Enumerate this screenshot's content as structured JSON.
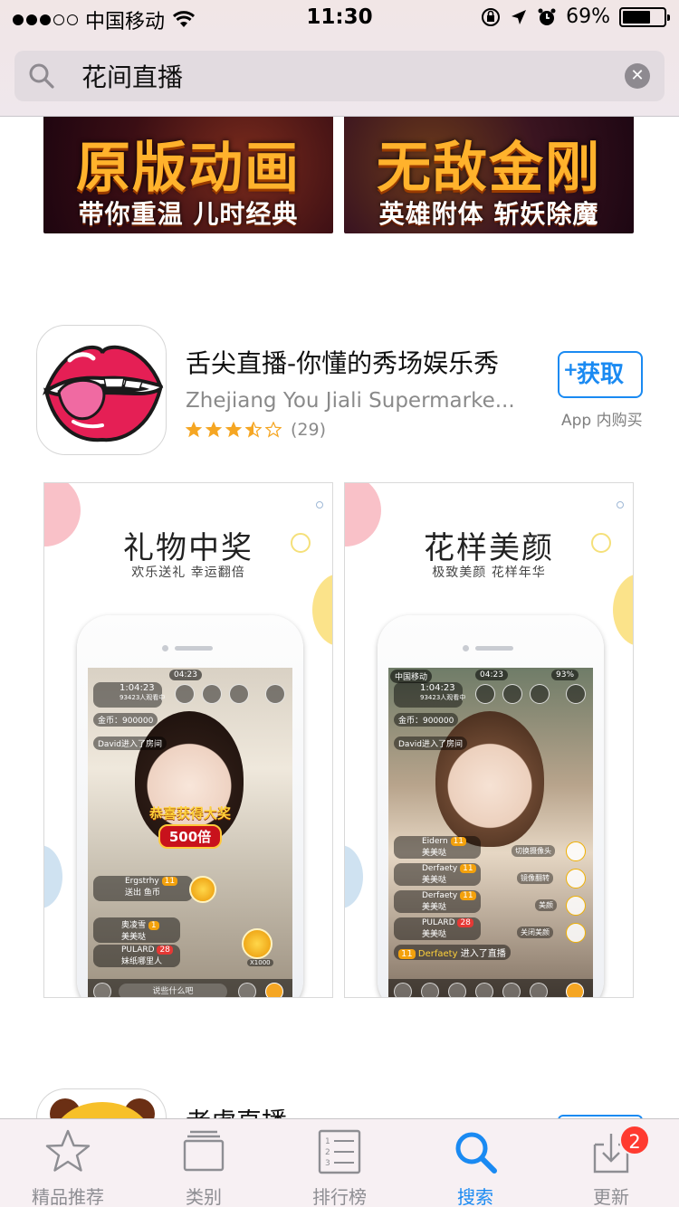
{
  "status_bar": {
    "carrier": "中国移动",
    "time": "11:30",
    "battery_percent": "69%",
    "battery_level": 0.69,
    "signal_bars_filled": 3,
    "signal_bars_total": 5
  },
  "search": {
    "query": "花间直播"
  },
  "banners": [
    {
      "headline": "原版动画",
      "tagline": "带你重温 儿时经典"
    },
    {
      "headline": "无敌金刚",
      "tagline": "英雄附体 斩妖除魔"
    }
  ],
  "app": {
    "title": "舌尖直播-你懂的秀场娱乐秀",
    "developer": "Zhejiang You Jiali Supermarke...",
    "rating_stars": 3.5,
    "rating_count": "(29)",
    "get_label": "获取",
    "get_plus": "+",
    "iap_note": "App 内购买"
  },
  "screenshots": [
    {
      "headline": "礼物中奖",
      "sub": "欢乐送礼  幸运翻倍",
      "status_time": "04:23",
      "live_time": "1:04:23",
      "viewers": "93423人观看中",
      "coins": "金币：900000",
      "join_msg": "David进入了房间",
      "award_title": "恭喜获得大奖",
      "award_value": "500倍",
      "gift_user": "Ergstrhy",
      "gift_level": "11",
      "gift_text": "送出  鱼币",
      "chat1_user": "奥凌雪",
      "chat1_level": "1",
      "chat1_text": "美美哒",
      "chat2_user": "PULARD",
      "chat2_level": "28",
      "chat2_text": "妹纸哪里人",
      "multiplier": "X1000",
      "input_placeholder": "说些什么吧"
    },
    {
      "headline": "花样美颜",
      "sub": "极致美颜  花样年华",
      "status_time": "04:23",
      "carrier": "中国移动",
      "battery": "93%",
      "live_time": "1:04:23",
      "viewers": "93423人观看中",
      "coins": "金币：900000",
      "join_msg": "David进入了房间",
      "chat1_user": "Eidern",
      "chat1_level": "11",
      "chat1_text": "美美哒",
      "chat2_user": "Derfaety",
      "chat2_level": "11",
      "chat2_text": "美美哒",
      "chat3_user": "Derfaety",
      "chat3_level": "11",
      "chat3_text": "美美哒",
      "chat4_user": "PULARD",
      "chat4_level": "28",
      "chat4_text": "美美哒",
      "enter_level": "11",
      "enter_user": "Derfaety",
      "enter_text": "进入了直播",
      "side_labels": [
        "切换摄像头",
        "镜像翻转",
        "美颜",
        "关闭美颜"
      ]
    }
  ],
  "next_app": {
    "title": "老虎直播"
  },
  "tabbar": {
    "tabs": [
      {
        "label": "精品推荐",
        "icon": "star-icon"
      },
      {
        "label": "类别",
        "icon": "categories-icon"
      },
      {
        "label": "排行榜",
        "icon": "top-charts-icon"
      },
      {
        "label": "搜索",
        "icon": "search-icon",
        "active": true
      },
      {
        "label": "更新",
        "icon": "updates-icon",
        "badge": "2"
      }
    ]
  },
  "colors": {
    "accent": "#1a8af2",
    "star": "#f5a623",
    "badge": "#ff3b30",
    "banner_text": "#ffb22c"
  }
}
